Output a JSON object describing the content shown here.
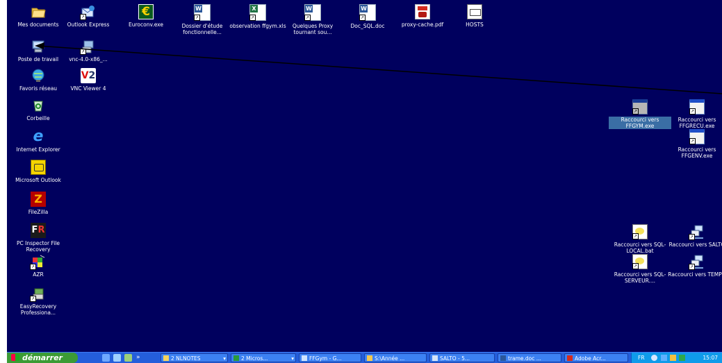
{
  "desktop": {
    "icons": [
      {
        "label": "Mes documents",
        "icon": "my-documents-folder-icon"
      },
      {
        "label": "Outlook Express",
        "icon": "outlook-express-icon"
      },
      {
        "label": "Euroconv.exe",
        "icon": "euro-converter-icon"
      },
      {
        "label": "Dossier d'étude fonctionnelle...",
        "icon": "word-document-icon"
      },
      {
        "label": "observation ffgym.xls",
        "icon": "excel-document-icon"
      },
      {
        "label": "Quelques Proxy tournant sou...",
        "icon": "word-document-icon"
      },
      {
        "label": "Doc_SQL.doc",
        "icon": "word-document-icon"
      },
      {
        "label": "proxy-cache.pdf",
        "icon": "pdf-document-icon"
      },
      {
        "label": "HOSTS",
        "icon": "hosts-file-icon"
      },
      {
        "label": "Poste de travail",
        "icon": "my-computer-icon"
      },
      {
        "label": "vnc-4.0-x86_...",
        "icon": "vnc-installer-icon"
      },
      {
        "label": "Favoris réseau",
        "icon": "network-places-icon"
      },
      {
        "label": "VNC Viewer 4",
        "icon": "vnc-viewer-icon"
      },
      {
        "label": "Corbeille",
        "icon": "recycle-bin-icon"
      },
      {
        "label": "Internet Explorer",
        "icon": "internet-explorer-icon"
      },
      {
        "label": "Microsoft Outlook",
        "icon": "microsoft-outlook-icon"
      },
      {
        "label": "FileZilla",
        "icon": "filezilla-icon"
      },
      {
        "label": "PC Inspector File Recovery",
        "icon": "pc-inspector-icon"
      },
      {
        "label": "AZR",
        "icon": "azr-icon"
      },
      {
        "label": "EasyRecovery Professiona...",
        "icon": "easyrecovery-icon"
      },
      {
        "label": "Raccourci vers FFGYM.exe",
        "icon": "application-shortcut-icon"
      },
      {
        "label": "Raccourci vers FFGRECU.exe",
        "icon": "application-shortcut-icon"
      },
      {
        "label": "Raccourci vers FFGENV.exe",
        "icon": "application-shortcut-icon"
      },
      {
        "label": "Raccourci vers SQL-LOCAL.bat",
        "icon": "batch-file-shortcut-icon"
      },
      {
        "label": "Raccourci vers SALTO",
        "icon": "network-computer-shortcut-icon"
      },
      {
        "label": "Raccourci vers SQL-SERVEUR....",
        "icon": "batch-file-shortcut-icon"
      },
      {
        "label": "Raccourci vers TEMPO",
        "icon": "network-computer-shortcut-icon"
      }
    ]
  },
  "taskbar": {
    "start_label": "démarrer",
    "overflow_chevron": "»",
    "buttons": [
      {
        "label": "2 NLNOTES",
        "icon": "lotus-notes-icon"
      },
      {
        "label": "2 Micros...",
        "icon": "excel-icon"
      },
      {
        "label": "FFGym - G...",
        "icon": "ffgym-app-icon"
      },
      {
        "label": "S:\\Année ...",
        "icon": "folder-icon"
      },
      {
        "label": "SALTO - 5...",
        "icon": "network-computer-icon"
      },
      {
        "label": "trame.doc ...",
        "icon": "word-icon"
      },
      {
        "label": "Adobe Acr...",
        "icon": "adobe-acrobat-icon"
      }
    ],
    "tray": {
      "language": "FR",
      "clock": "15:07"
    }
  },
  "colors": {
    "desktop": "#00005e",
    "taskbar": "#245edb",
    "start": "#3c9b35",
    "tray": "#0f9bea"
  }
}
